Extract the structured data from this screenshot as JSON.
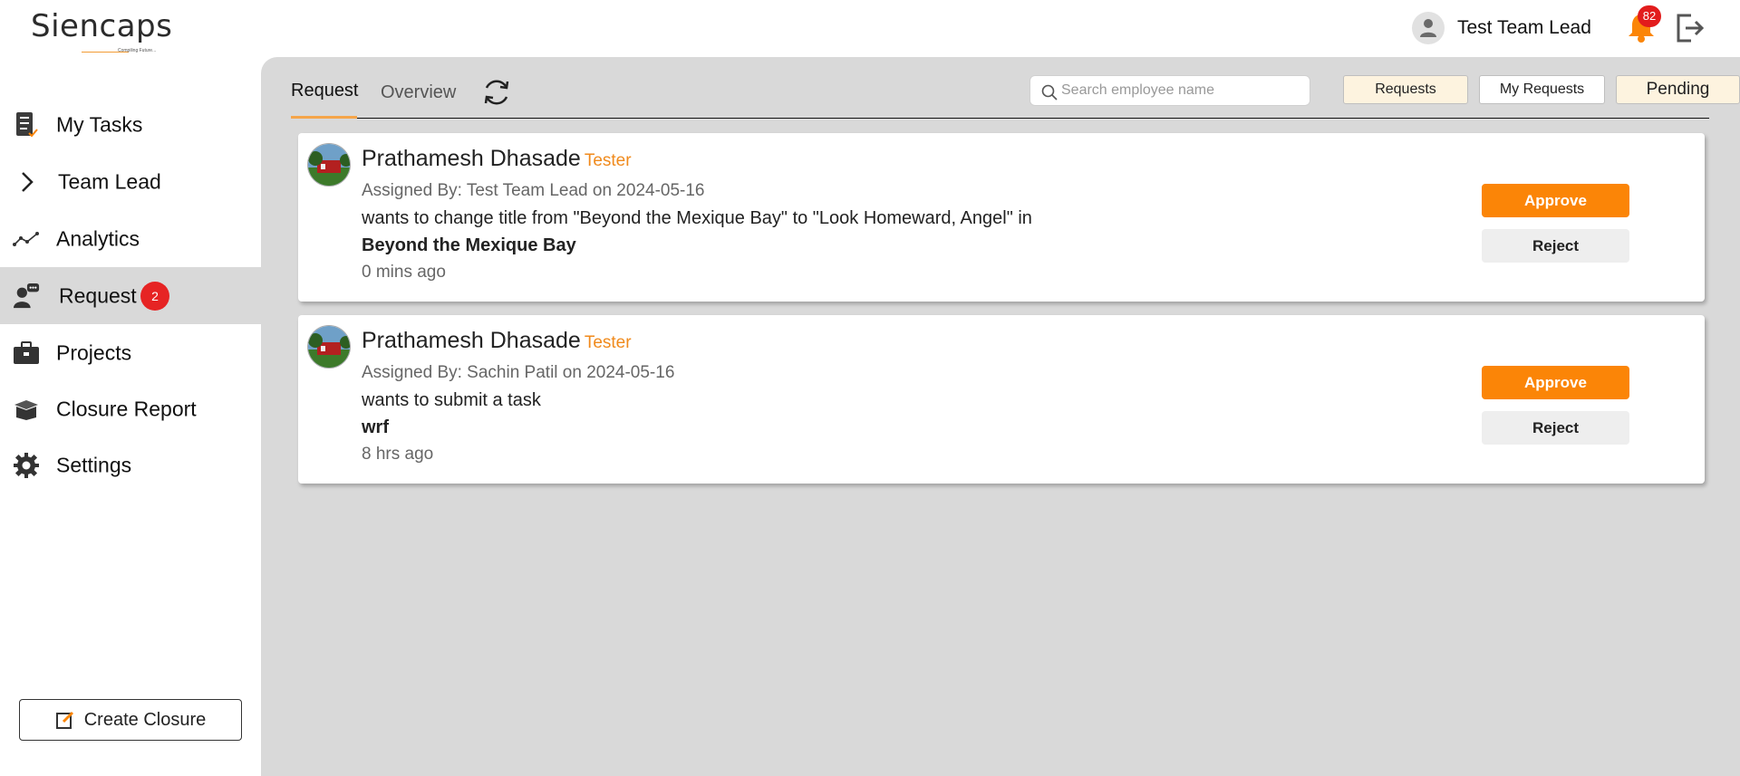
{
  "header": {
    "logo_text": "Siencaps",
    "logo_tagline": "Compiling Future...",
    "user_name": "Test Team Lead",
    "notification_count": "82",
    "icons": {
      "avatar": "user-icon",
      "notifications": "bell-icon",
      "logout": "logout-icon"
    },
    "accent_color": "#f5a54a"
  },
  "sidebar": {
    "items": [
      {
        "label": "My Tasks",
        "icon": "task-list-icon"
      },
      {
        "label": "Team Lead",
        "icon": "chevron-right-icon"
      },
      {
        "label": "Analytics",
        "icon": "analytics-icon"
      },
      {
        "label": "Request",
        "icon": "request-icon",
        "badge": "2",
        "active": true
      },
      {
        "label": "Projects",
        "icon": "briefcase-icon"
      },
      {
        "label": "Closure Report",
        "icon": "box-icon"
      },
      {
        "label": "Settings",
        "icon": "gear-icon"
      }
    ],
    "create_closure_label": "Create Closure"
  },
  "main": {
    "tabs": [
      {
        "label": "Request",
        "active": true
      },
      {
        "label": "Overview",
        "active": false
      }
    ],
    "search_placeholder": "Search employee name",
    "filters": [
      {
        "label": "Requests"
      },
      {
        "label": "My Requests"
      },
      {
        "label": "Pending"
      }
    ],
    "requests": [
      {
        "name": "Prathamesh Dhasade",
        "role": "Tester",
        "assigned": "Assigned By: Test Team Lead on 2024-05-16",
        "action": "wants to change title from \"Beyond the Mexique Bay\" to \"Look Homeward, Angel\" in",
        "subject": "Beyond the Mexique Bay",
        "time": "0 mins ago",
        "approve_label": "Approve",
        "reject_label": "Reject"
      },
      {
        "name": "Prathamesh Dhasade",
        "role": "Tester",
        "assigned": "Assigned By: Sachin Patil on 2024-05-16",
        "action": "wants to submit a task",
        "subject": "wrf",
        "time": "8 hrs ago",
        "approve_label": "Approve",
        "reject_label": "Reject"
      }
    ],
    "colors": {
      "approve": "#fb8507",
      "role": "#f08a1c",
      "badge": "#e62424"
    }
  }
}
